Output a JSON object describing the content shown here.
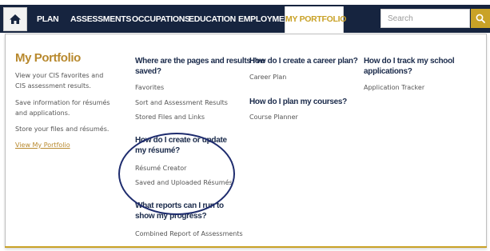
{
  "nav": {
    "home_icon": "home-icon",
    "items": [
      "PLAN",
      "ASSESSMENTS",
      "OCCUPATIONS",
      "EDUCATION",
      "EMPLOYMENT",
      "MY PORTFOLIO"
    ],
    "active_item": "MY PORTFOLIO",
    "search_placeholder": "Search",
    "search_icon": "magnifier-icon"
  },
  "colors": {
    "navbar": "#16243f",
    "accent_gold": "#c9a227",
    "heading_navy": "#1b2b4b",
    "annotation_circle": "#1e2c6e"
  },
  "portfolio": {
    "title": "My Portfolio",
    "desc1": "View your CIS favorites and CIS assessment results.",
    "desc2": "Save information for résumés and applications.",
    "desc3": "Store your files and résumés.",
    "link": "View My Portfolio"
  },
  "col1": {
    "q1": "Where are the pages and results I've saved?",
    "q1_links": [
      "Favorites",
      "Sort and Assessment Results",
      "Stored Files and Links"
    ],
    "q2": "How do I create or update my résumé?",
    "q2_links": [
      "Résumé Creator",
      "Saved and Uploaded Résumés"
    ],
    "q3": "What reports can I run to show my progress?",
    "q3_links": [
      "Combined Report of Assessments"
    ]
  },
  "col2": {
    "q1": "How do I create a career plan?",
    "q1_links": [
      "Career Plan"
    ],
    "q2": "How do I plan my courses?",
    "q2_links": [
      "Course Planner"
    ]
  },
  "col3": {
    "q1": "How do I track my school applications?",
    "q1_links": [
      "Application Tracker"
    ]
  }
}
